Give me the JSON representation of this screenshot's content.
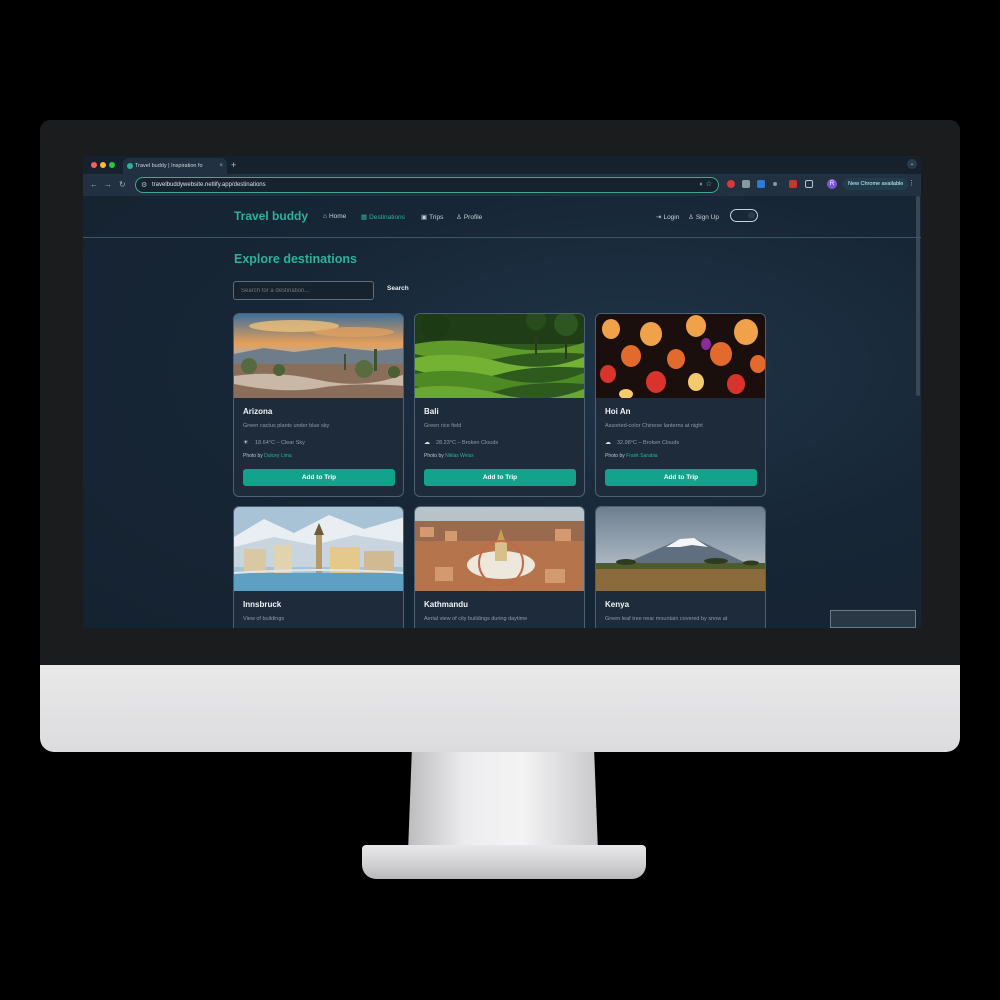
{
  "browser": {
    "tab_title": "Travel buddy | Inspiration fo",
    "tab_close": "×",
    "new_tab": "+",
    "url": "travelbuddywebsite.netlify.app/destinations",
    "update_chip": "New Chrome available",
    "profile_initial": "R"
  },
  "site": {
    "brand": "Travel buddy",
    "nav": [
      {
        "label": "Home",
        "icon": "home-icon",
        "glyph": "⌂"
      },
      {
        "label": "Destinations",
        "icon": "map-icon",
        "glyph": "▦"
      },
      {
        "label": "Trips",
        "icon": "suitcase-icon",
        "glyph": "▣"
      },
      {
        "label": "Profile",
        "icon": "user-icon",
        "glyph": "♙"
      }
    ],
    "auth": [
      {
        "label": "Login",
        "icon": "login-icon",
        "glyph": "⇥"
      },
      {
        "label": "Sign Up",
        "icon": "user-plus-icon",
        "glyph": "♙"
      }
    ],
    "active_nav": "Destinations",
    "accent_color": "#2bb39a"
  },
  "main": {
    "title": "Explore destinations",
    "search": {
      "placeholder": "Search for a destination...",
      "button": "Search"
    },
    "cards": [
      {
        "name": "Arizona",
        "description": "Green cactus plants under blue sky",
        "weather": "18.64°C – Clear Sky",
        "weather_icon": "sun-icon",
        "credit_prefix": "Photo by ",
        "photographer": "Dulcey Lima",
        "button": "Add to Trip"
      },
      {
        "name": "Bali",
        "description": "Green rice field",
        "weather": "28.23°C – Broken Clouds",
        "weather_icon": "cloud-icon",
        "credit_prefix": "Photo by ",
        "photographer": "Niklas Weiss",
        "button": "Add to Trip"
      },
      {
        "name": "Hoi An",
        "description": "Assorted-color Chinese lanterns at night",
        "weather": "32.98°C – Broken Clouds",
        "weather_icon": "cloud-icon",
        "credit_prefix": "Photo by ",
        "photographer": "Frank Sarabia",
        "button": "Add to Trip"
      },
      {
        "name": "Innsbruck",
        "description": "View of buildings"
      },
      {
        "name": "Kathmandu",
        "description": "Aerial view of city buildings during daytime"
      },
      {
        "name": "Kenya",
        "description": "Green leaf tree near mountain covered by snow at"
      }
    ]
  }
}
